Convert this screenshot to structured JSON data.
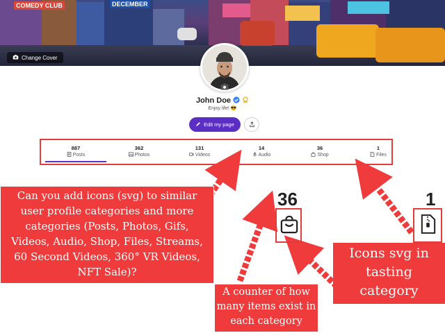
{
  "cover": {
    "change_cover_label": "Change Cover",
    "signs": [
      "COMEDY CLUB",
      "DECEMBER"
    ]
  },
  "profile": {
    "name": "John Doe",
    "bio": "Enjoy life! 😎",
    "edit_label": "Edit my page",
    "verified_color": "#3b82f6",
    "badge_color": "#e8b325"
  },
  "tabs": [
    {
      "count": "887",
      "label": "Posts",
      "icon": "document-icon",
      "active": true
    },
    {
      "count": "362",
      "label": "Photos",
      "icon": "image-icon",
      "active": false
    },
    {
      "count": "131",
      "label": "Videos",
      "icon": "video-icon",
      "active": false
    },
    {
      "count": "14",
      "label": "Audio",
      "icon": "mic-icon",
      "active": false
    },
    {
      "count": "36",
      "label": "Shop",
      "icon": "bag-icon",
      "active": false
    },
    {
      "count": "1",
      "label": "Files",
      "icon": "file-zip-icon",
      "active": false
    }
  ],
  "annotations": {
    "main": "Can you add icons (svg) to similar user profile categories and more categories (Posts, Photos, Gifs, Videos, Audio, Shop, Files, Streams, 60 Second Videos, 360° VR Videos, NFT Sale)?",
    "counter": "A counter of how many items exist in each category",
    "icons": "Icons svg in tasting category",
    "big_shop_count": "36",
    "big_files_count": "1"
  },
  "colors": {
    "accent": "#5b2fc4",
    "annotation_red": "#ef3b3b",
    "highlight_border": "#e23b3b"
  }
}
